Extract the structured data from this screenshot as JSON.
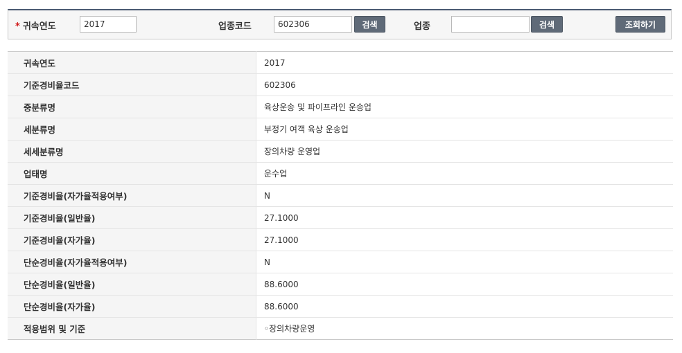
{
  "search": {
    "year_label": "귀속연도",
    "year_value": "2017",
    "code_label": "업종코드",
    "code_value": "602306",
    "code_search_button": "검색",
    "industry_label": "업종",
    "industry_value": "",
    "industry_search_button": "검색",
    "query_button": "조회하기",
    "required_marker": "*"
  },
  "detail_rows": [
    {
      "label": "귀속연도",
      "value": "2017"
    },
    {
      "label": "기준경비율코드",
      "value": "602306"
    },
    {
      "label": "중분류명",
      "value": "육상운송 및 파이프라인 운송업"
    },
    {
      "label": "세분류명",
      "value": "부정기 여객 육상 운송업"
    },
    {
      "label": "세세분류명",
      "value": "장의차량 운영업"
    },
    {
      "label": "업태명",
      "value": "운수업"
    },
    {
      "label": "기준경비율(자가율적용여부)",
      "value": "N"
    },
    {
      "label": "기준경비율(일반율)",
      "value": "27.1000"
    },
    {
      "label": "기준경비율(자가율)",
      "value": "27.1000"
    },
    {
      "label": "단순경비율(자가율적용여부)",
      "value": "N"
    },
    {
      "label": "단순경비율(일반율)",
      "value": "88.6000"
    },
    {
      "label": "단순경비율(자가율)",
      "value": "88.6000"
    },
    {
      "label": "적용범위 및 기준",
      "value": "◦장의차량운영"
    }
  ],
  "colors": {
    "panel_top_border": "#4a5a72",
    "button_bg": "#5f6a78",
    "required": "#d01616",
    "header_cell_bg": "#f5f5f5"
  }
}
